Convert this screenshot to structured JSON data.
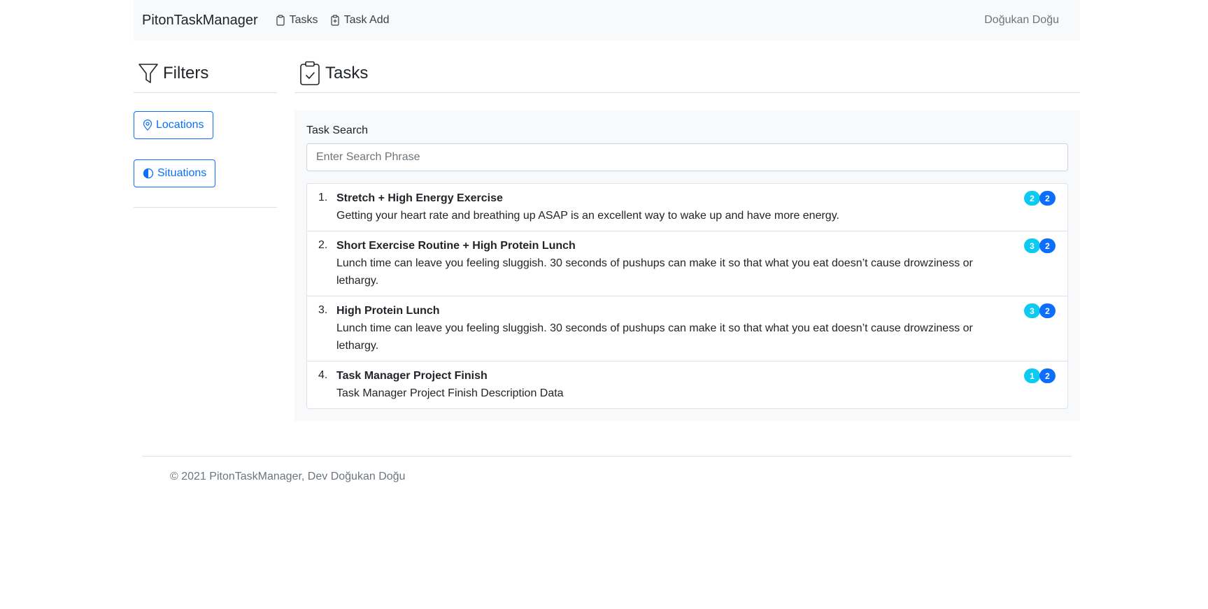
{
  "navbar": {
    "brand": "PitonTaskManager",
    "links": [
      {
        "label": "Tasks",
        "icon": "clipboard-icon"
      },
      {
        "label": "Task Add",
        "icon": "clipboard-plus-icon"
      }
    ],
    "user": "Doğukan Doğu"
  },
  "sidebar": {
    "title": "Filters",
    "title_icon": "funnel-icon",
    "filters": [
      {
        "label": "Locations",
        "icon": "location-pin-icon"
      },
      {
        "label": "Situations",
        "icon": "half-circle-icon"
      }
    ]
  },
  "main": {
    "title": "Tasks",
    "title_icon": "clipboard-check-icon",
    "search": {
      "label": "Task Search",
      "placeholder": "Enter Search Phrase",
      "value": ""
    },
    "tasks": [
      {
        "num": "1.",
        "title": "Stretch + High Energy Exercise",
        "description": "Getting your heart rate and breathing up ASAP is an excellent way to wake up and have more energy.",
        "badge1": "2",
        "badge2": "2"
      },
      {
        "num": "2.",
        "title": "Short Exercise Routine + High Protein Lunch",
        "description": "Lunch time can leave you feeling sluggish. 30 seconds of pushups can make it so that what you eat doesn’t cause drowziness or lethargy.",
        "badge1": "3",
        "badge2": "2"
      },
      {
        "num": "3.",
        "title": "High Protein Lunch",
        "description": "Lunch time can leave you feeling sluggish. 30 seconds of pushups can make it so that what you eat doesn’t cause drowziness or lethargy.",
        "badge1": "3",
        "badge2": "2"
      },
      {
        "num": "4.",
        "title": "Task Manager Project Finish",
        "description": "Task Manager Project Finish Description Data",
        "badge1": "1",
        "badge2": "2"
      }
    ]
  },
  "footer": {
    "text": "© 2021 PitonTaskManager, Dev Doğukan Doğu"
  },
  "colors": {
    "primary": "#0d6efd",
    "info": "#0dcaf0",
    "navbar_bg": "#f8f9fa",
    "muted": "#6c757d"
  }
}
